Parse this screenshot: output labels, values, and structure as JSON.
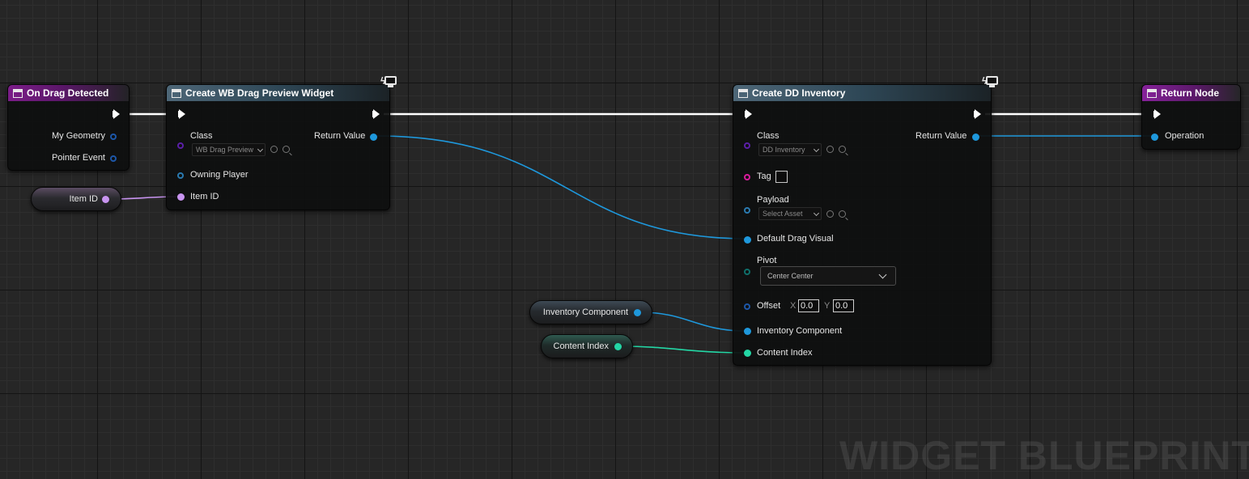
{
  "watermark": "WIDGET BLUEPRINT",
  "nodes": {
    "on_drag_detected": {
      "title": "On Drag Detected",
      "outputs": [
        "My Geometry",
        "Pointer Event"
      ]
    },
    "create_wb_drag_preview": {
      "title": "Create WB Drag Preview Widget",
      "class_label": "Class",
      "class_value": "WB Drag Preview",
      "owning_player": "Owning Player",
      "item_id": "Item ID",
      "return_value": "Return Value"
    },
    "create_dd_inventory": {
      "title": "Create DD Inventory",
      "class_label": "Class",
      "class_value": "DD Inventory",
      "tag_label": "Tag",
      "payload_label": "Payload",
      "payload_value": "Select Asset",
      "default_drag_visual": "Default Drag Visual",
      "pivot_label": "Pivot",
      "pivot_value": "Center Center",
      "offset_label": "Offset",
      "offset_x_label": "X",
      "offset_x": "0.0",
      "offset_y_label": "Y",
      "offset_y": "0.0",
      "inventory_component": "Inventory Component",
      "content_index": "Content Index",
      "return_value": "Return Value"
    },
    "return_node": {
      "title": "Return Node",
      "operation": "Operation"
    }
  },
  "variables": {
    "item_id": "Item ID",
    "inventory_component": "Inventory Component",
    "content_index": "Content Index"
  },
  "colors": {
    "exec_wire": "#ffffff",
    "object_wire": "#1e98dc",
    "name_wire": "#c894f0",
    "int_wire": "#23d7a5",
    "event_header": "#7b1d88",
    "function_header": "#4d6677"
  }
}
